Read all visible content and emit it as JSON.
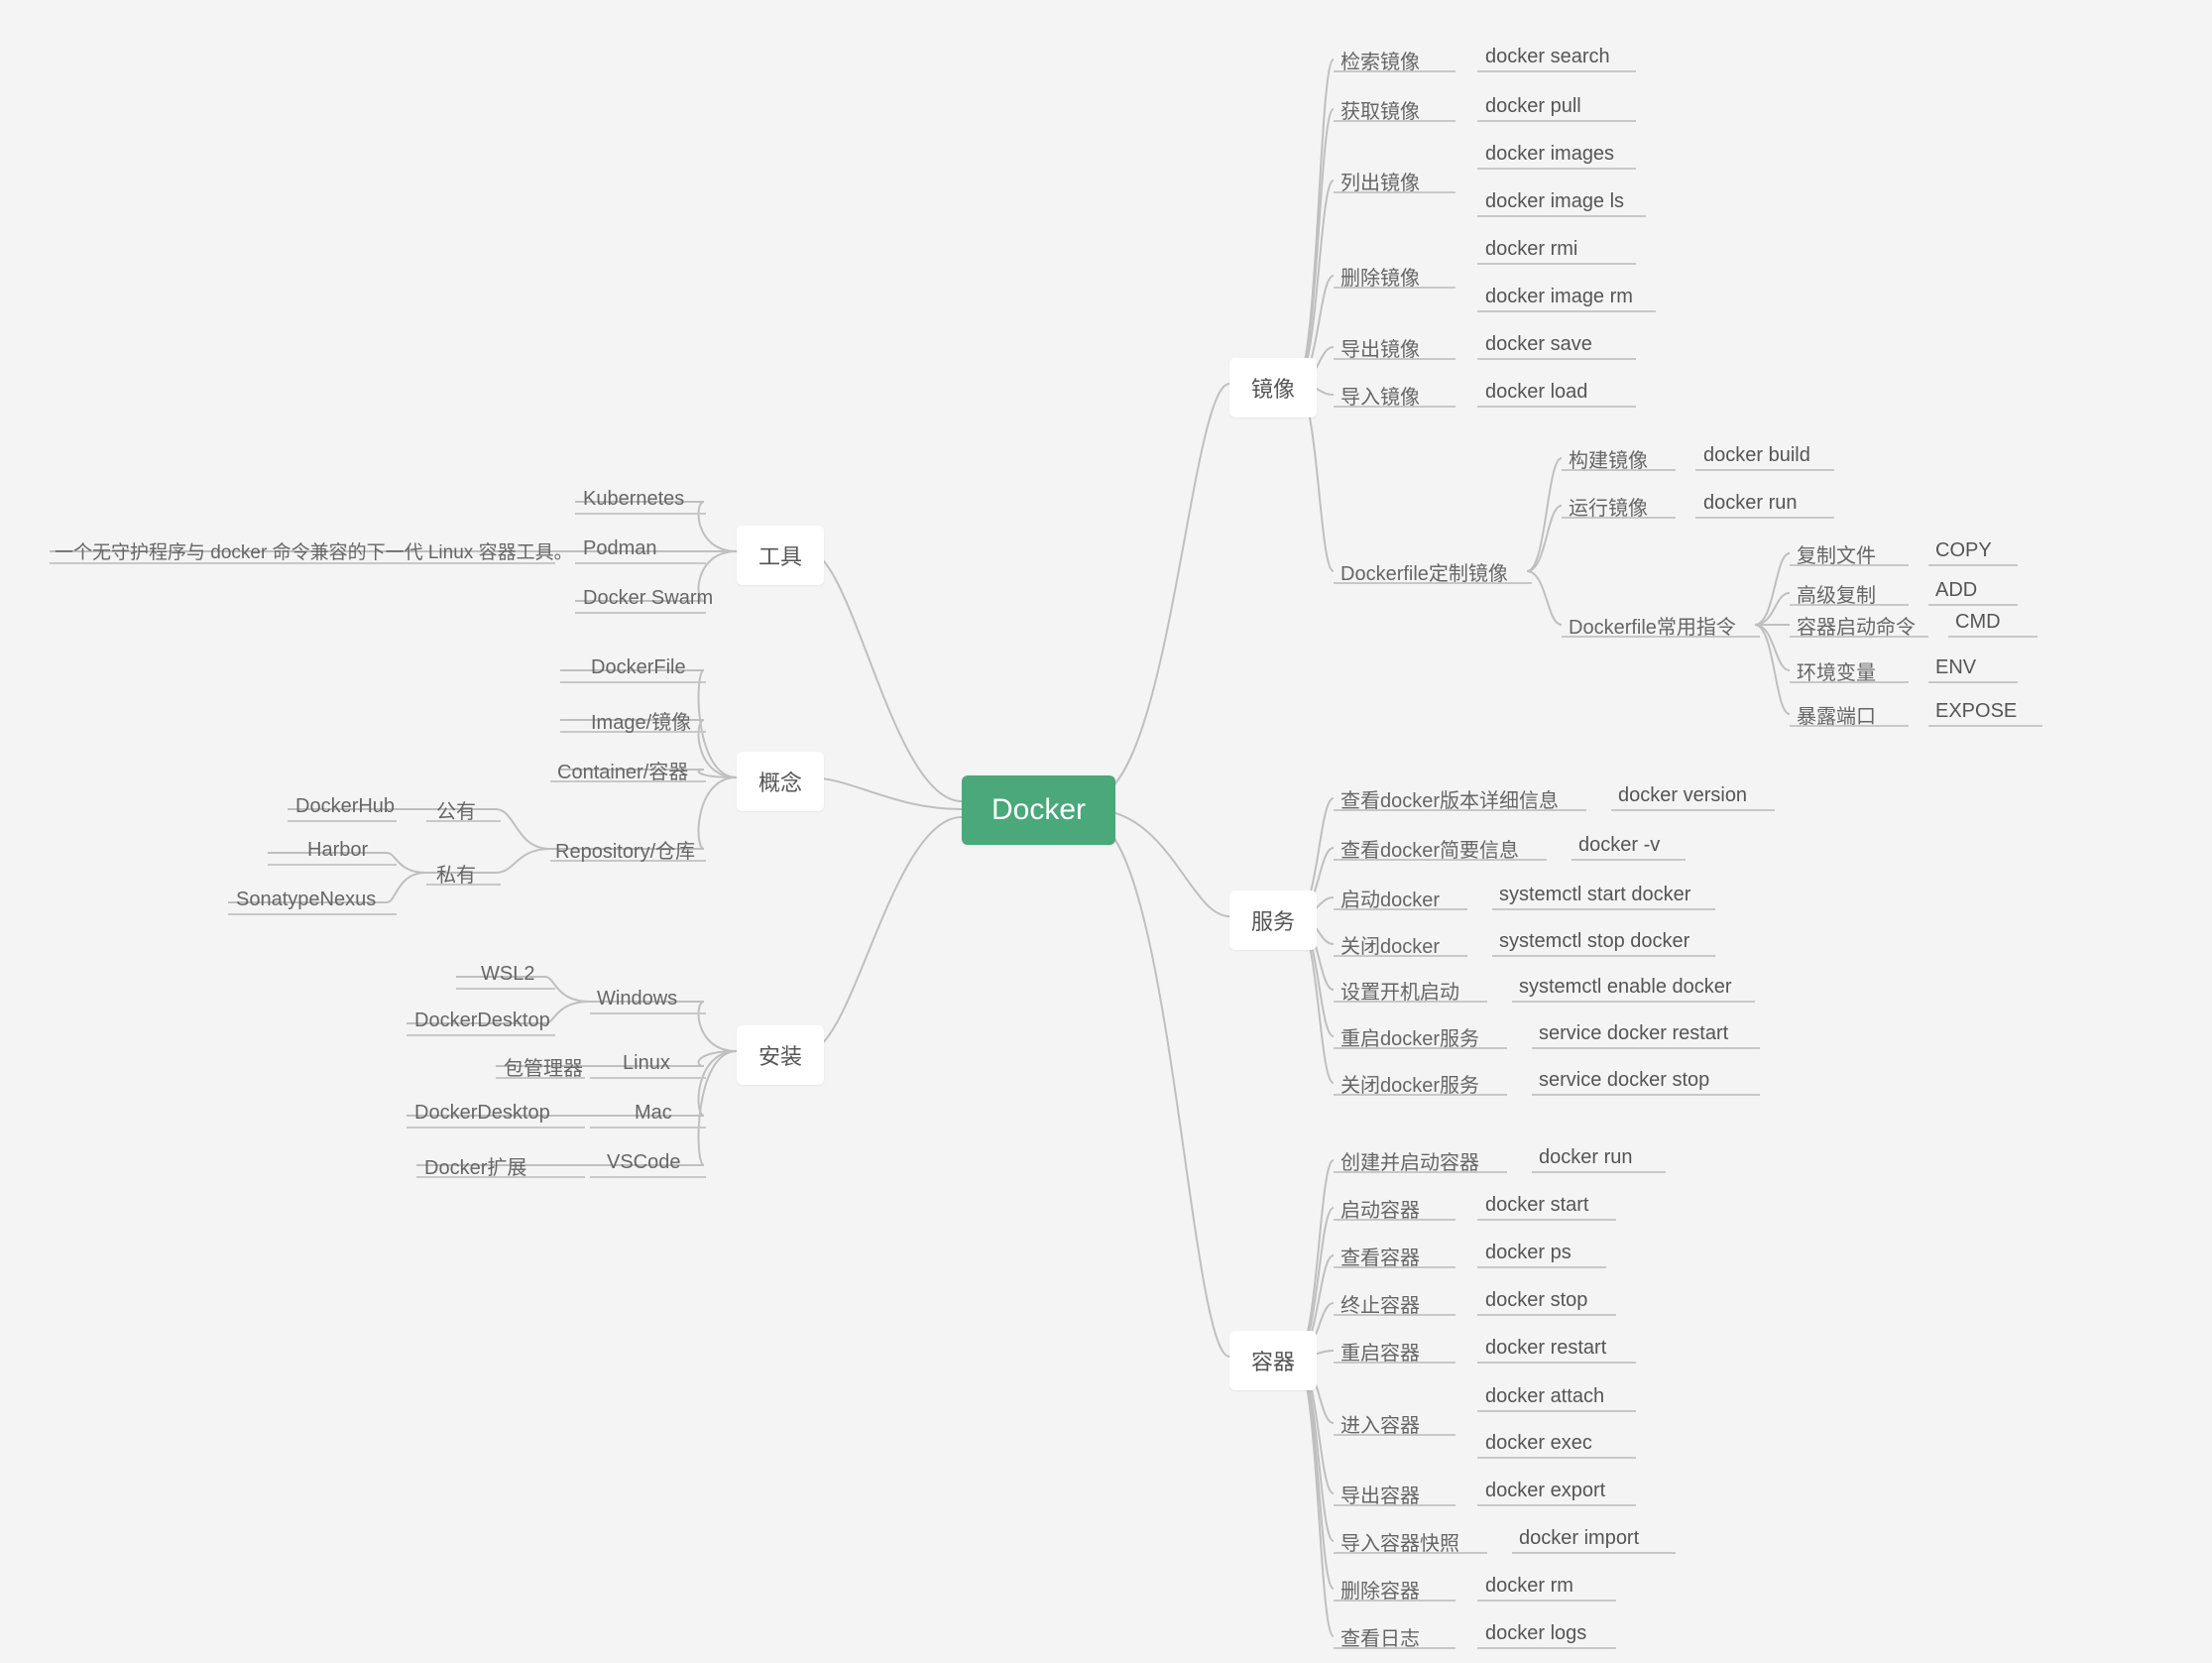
{
  "root": "Docker",
  "left": {
    "tools": {
      "title": "工具",
      "items": [
        "Kubernetes",
        "Podman",
        "Docker Swarm"
      ],
      "podman_note": "一个无守护程序与 docker 命令兼容的下一代 Linux 容器工具。"
    },
    "concepts": {
      "title": "概念",
      "items": [
        "DockerFile",
        "Image/镜像",
        "Container/容器",
        "Repository/仓库"
      ],
      "repo": {
        "public": {
          "label": "公有",
          "items": [
            "DockerHub"
          ]
        },
        "private": {
          "label": "私有",
          "items": [
            "Harbor",
            "SonatypeNexus"
          ]
        }
      }
    },
    "install": {
      "title": "安装",
      "rows": [
        {
          "os": "Windows",
          "items": [
            "WSL2",
            "DockerDesktop"
          ]
        },
        {
          "os": "Linux",
          "items": [
            "包管理器"
          ]
        },
        {
          "os": "Mac",
          "items": [
            "DockerDesktop"
          ]
        },
        {
          "os": "VSCode",
          "items": [
            "Docker扩展"
          ]
        }
      ]
    }
  },
  "right": {
    "image": {
      "title": "镜像",
      "rows": [
        {
          "label": "检索镜像",
          "cmds": [
            "docker search"
          ]
        },
        {
          "label": "获取镜像",
          "cmds": [
            "docker pull"
          ]
        },
        {
          "label": "列出镜像",
          "cmds": [
            "docker images",
            "docker image ls"
          ]
        },
        {
          "label": "删除镜像",
          "cmds": [
            "docker rmi",
            "docker image rm"
          ]
        },
        {
          "label": "导出镜像",
          "cmds": [
            "docker save"
          ]
        },
        {
          "label": "导入镜像",
          "cmds": [
            "docker load"
          ]
        }
      ],
      "dockerfile": {
        "label": "Dockerfile定制镜像",
        "build": {
          "label": "构建镜像",
          "cmd": "docker build"
        },
        "run": {
          "label": "运行镜像",
          "cmd": "docker run"
        },
        "common": {
          "label": "Dockerfile常用指令",
          "rows": [
            {
              "label": "复制文件",
              "cmd": "COPY"
            },
            {
              "label": "高级复制",
              "cmd": "ADD"
            },
            {
              "label": "容器启动命令",
              "cmd": "CMD"
            },
            {
              "label": "环境变量",
              "cmd": "ENV"
            },
            {
              "label": "暴露端口",
              "cmd": "EXPOSE"
            }
          ]
        }
      }
    },
    "service": {
      "title": "服务",
      "rows": [
        {
          "label": "查看docker版本详细信息",
          "cmd": "docker version"
        },
        {
          "label": "查看docker简要信息",
          "cmd": "docker -v"
        },
        {
          "label": "启动docker",
          "cmd": "systemctl start docker"
        },
        {
          "label": "关闭docker",
          "cmd": "systemctl stop docker"
        },
        {
          "label": "设置开机启动",
          "cmd": "systemctl enable docker"
        },
        {
          "label": "重启docker服务",
          "cmd": "service docker restart"
        },
        {
          "label": "关闭docker服务",
          "cmd": "service docker stop"
        }
      ]
    },
    "container": {
      "title": "容器",
      "rows": [
        {
          "label": "创建并启动容器",
          "cmds": [
            "docker run"
          ]
        },
        {
          "label": "启动容器",
          "cmds": [
            "docker start"
          ]
        },
        {
          "label": "查看容器",
          "cmds": [
            "docker ps"
          ]
        },
        {
          "label": "终止容器",
          "cmds": [
            "docker stop"
          ]
        },
        {
          "label": "重启容器",
          "cmds": [
            "docker restart"
          ]
        },
        {
          "label": "进入容器",
          "cmds": [
            "docker attach",
            "docker exec"
          ]
        },
        {
          "label": "导出容器",
          "cmds": [
            "docker export"
          ]
        },
        {
          "label": "导入容器快照",
          "cmds": [
            "docker import"
          ]
        },
        {
          "label": "删除容器",
          "cmds": [
            "docker rm"
          ]
        },
        {
          "label": "查看日志",
          "cmds": [
            "docker logs"
          ]
        }
      ]
    }
  }
}
